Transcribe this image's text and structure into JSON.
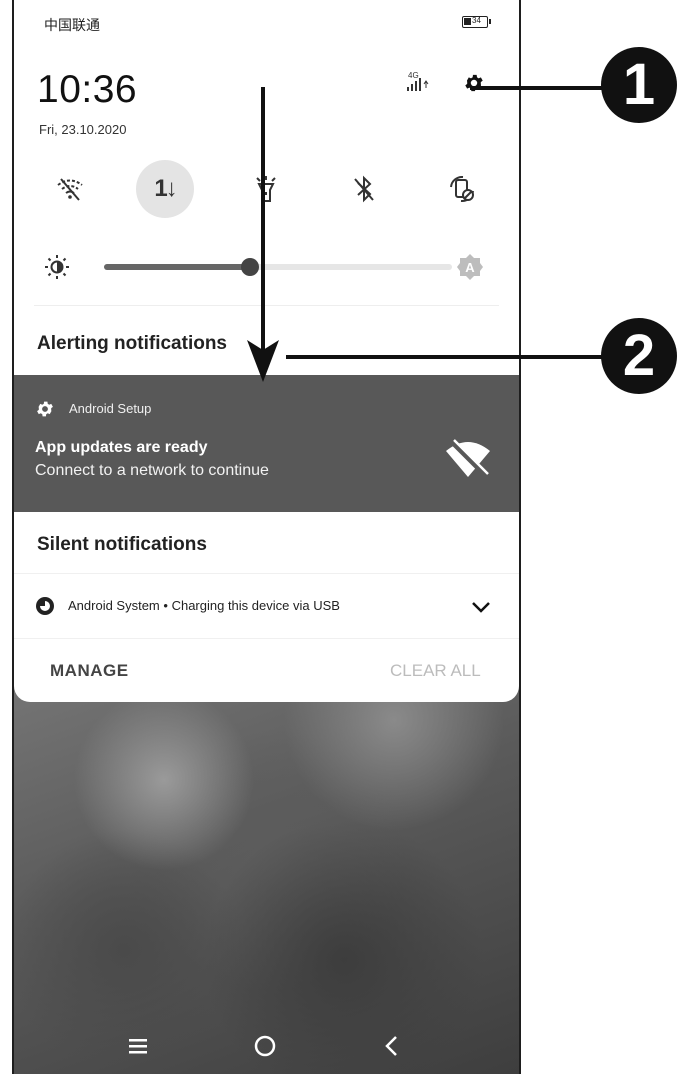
{
  "status_bar": {
    "carrier": "中国联通",
    "battery": "34"
  },
  "clock": {
    "time": "10:36",
    "date": "Fri, 23.10.2020"
  },
  "signal_label": "4G",
  "quick_settings": {
    "tiles": [
      "wifi-off-icon",
      "mobile-data-icon",
      "flashlight-icon",
      "bluetooth-off-icon",
      "auto-rotate-icon"
    ],
    "data_tile_label": "1↓",
    "brightness": 0.42,
    "auto_brightness_label": "A"
  },
  "alerting": {
    "title": "Alerting notifications",
    "app_name": "Android Setup",
    "notif_title": "App updates are ready",
    "notif_text": "Connect to a network to continue"
  },
  "silent": {
    "title": "Silent notifications",
    "app_name": "Android System",
    "separator": "•",
    "text": "Charging this device via USB"
  },
  "actions": {
    "manage": "MANAGE",
    "clear_all": "CLEAR ALL"
  },
  "callouts": [
    "1",
    "2"
  ],
  "colors": {
    "panel": "#ffffff",
    "alert_card": "#585858",
    "callout": "#111111"
  }
}
